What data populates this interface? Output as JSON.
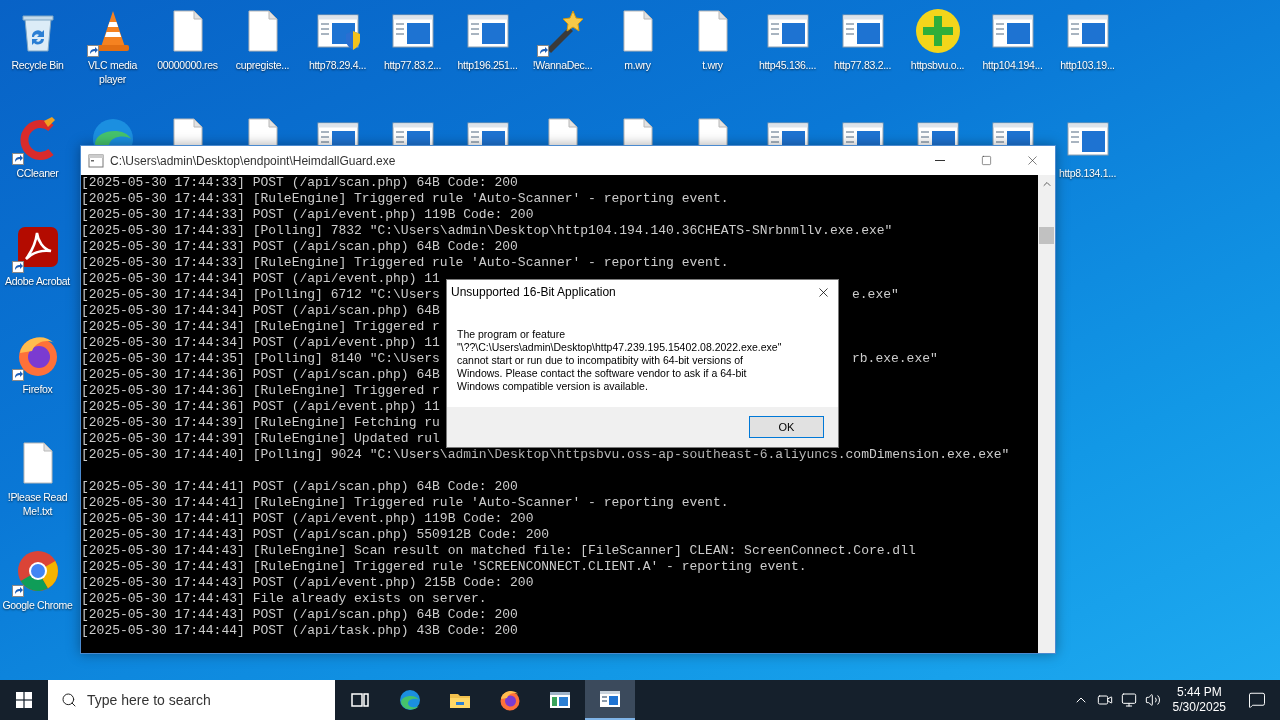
{
  "desktop": {
    "columns": [
      [
        {
          "kind": "recycle",
          "label": "Recycle Bin",
          "shortcut": false
        },
        {
          "kind": "ccleaner",
          "label": "CCleaner",
          "shortcut": true
        },
        {
          "kind": "acrobat",
          "label": "Adobe Acrobat",
          "shortcut": true
        },
        {
          "kind": "firefox",
          "label": "Firefox",
          "shortcut": true
        },
        {
          "kind": "file",
          "label": "!Please Read Me!.txt",
          "shortcut": false
        },
        {
          "kind": "chrome",
          "label": "Google Chrome",
          "shortcut": true
        }
      ],
      [
        {
          "kind": "vlc",
          "label": "VLC media player",
          "shortcut": true
        },
        {
          "kind": "edge",
          "shortcut": false
        }
      ],
      [
        {
          "kind": "file",
          "label": "00000000.res",
          "shortcut": false
        },
        {
          "kind": "file",
          "shortcut": false
        }
      ],
      [
        {
          "kind": "file",
          "label": "cupregiste...",
          "shortcut": false
        },
        {
          "kind": "file",
          "shortcut": false
        }
      ],
      [
        {
          "kind": "window_shield",
          "label": "http78.29.4...",
          "shortcut": false
        },
        {
          "kind": "window",
          "shortcut": false
        }
      ],
      [
        {
          "kind": "window",
          "label": "http77.83.2...",
          "shortcut": false
        },
        {
          "kind": "window",
          "shortcut": false
        }
      ],
      [
        {
          "kind": "window",
          "label": "http196.251...",
          "shortcut": false
        },
        {
          "kind": "window",
          "shortcut": false
        }
      ],
      [
        {
          "kind": "wand",
          "label": "!WannaDec...",
          "shortcut": true
        },
        {
          "kind": "file",
          "shortcut": false
        }
      ],
      [
        {
          "kind": "file",
          "label": "m.wry",
          "shortcut": false
        },
        {
          "kind": "file",
          "shortcut": false
        }
      ],
      [
        {
          "kind": "file",
          "label": "t.wry",
          "shortcut": false
        },
        {
          "kind": "file",
          "shortcut": false
        }
      ],
      [
        {
          "kind": "window",
          "label": "http45.136....",
          "shortcut": false
        },
        {
          "kind": "window",
          "shortcut": false
        }
      ],
      [
        {
          "kind": "window",
          "label": "http77.83.2...",
          "shortcut": false
        },
        {
          "kind": "window",
          "shortcut": false
        }
      ],
      [
        {
          "kind": "plus",
          "label": "httpsbvu.o...",
          "shortcut": false
        },
        {
          "kind": "window",
          "shortcut": false
        }
      ],
      [
        {
          "kind": "window",
          "label": "http104.194...",
          "shortcut": false
        },
        {
          "kind": "window",
          "shortcut": false
        }
      ],
      [
        {
          "kind": "window",
          "label": "http103.19...",
          "shortcut": false
        },
        {
          "kind": "window",
          "label": "http8.134.1...",
          "shortcut": false
        }
      ]
    ]
  },
  "console": {
    "title": "C:\\Users\\admin\\Desktop\\endpoint\\HeimdallGuard.exe",
    "line_groups": [
      [
        {
          "text": "[2025-05-30 17:44:33] POST (/api/scan.php) 64B Code: 200"
        },
        {
          "text": "[2025-05-30 17:44:33] [RuleEngine] Triggered rule 'Auto-Scanner' - reporting event."
        },
        {
          "text": "[2025-05-30 17:44:33] POST (/api/event.php) 119B Code: 200"
        },
        {
          "text": "[2025-05-30 17:44:33] [Polling] 7832 \"C:\\Users\\admin\\Desktop\\http104.194.140.36CHEATS-SNrbnmllv.exe.exe\""
        },
        {
          "text": "[2025-05-30 17:44:33] POST (/api/scan.php) 64B Code: 200"
        },
        {
          "text": "[2025-05-30 17:44:33] [RuleEngine] Triggered rule 'Auto-Scanner' - reporting event."
        },
        {
          "text": "[2025-05-30 17:44:34] POST (/api/event.php) 11"
        },
        {
          "text": "[2025-05-30 17:44:34] [Polling] 6712 \"C:\\Users",
          "tail": "e.exe\""
        },
        {
          "text": "[2025-05-30 17:44:34] POST (/api/scan.php) 64B"
        },
        {
          "text": "[2025-05-30 17:44:34] [RuleEngine] Triggered r"
        },
        {
          "text": "[2025-05-30 17:44:34] POST (/api/event.php) 11"
        },
        {
          "text": "[2025-05-30 17:44:35] [Polling] 8140 \"C:\\Users",
          "tail": "rb.exe.exe\""
        },
        {
          "text": "[2025-05-30 17:44:36] POST (/api/scan.php) 64B"
        },
        {
          "text": "[2025-05-30 17:44:36] [RuleEngine] Triggered r"
        },
        {
          "text": "[2025-05-30 17:44:36] POST (/api/event.php) 11"
        },
        {
          "text": "[2025-05-30 17:44:39] [RuleEngine] Fetching ru"
        },
        {
          "text": "[2025-05-30 17:44:39] [RuleEngine] Updated rul"
        },
        {
          "text": "[2025-05-30 17:44:40] [Polling] 9024 \"C:\\Users\\admin\\Desktop\\httpsbvu.oss-ap-southeast-6.aliyuncs.comDimension.exe.exe\""
        }
      ],
      [
        {
          "text": "[2025-05-30 17:44:41] POST (/api/scan.php) 64B Code: 200"
        },
        {
          "text": "[2025-05-30 17:44:41] [RuleEngine] Triggered rule 'Auto-Scanner' - reporting event."
        },
        {
          "text": "[2025-05-30 17:44:41] POST (/api/event.php) 119B Code: 200"
        },
        {
          "text": "[2025-05-30 17:44:43] POST (/api/scan.php) 550912B Code: 200"
        },
        {
          "text": "[2025-05-30 17:44:43] [RuleEngine] Scan result on matched file: [FileScanner] CLEAN: ScreenConnect.Core.dll"
        },
        {
          "text": "[2025-05-30 17:44:43] [RuleEngine] Triggered rule 'SCREENCONNECT.CLIENT.A' - reporting event."
        },
        {
          "text": "[2025-05-30 17:44:43] POST (/api/event.php) 215B Code: 200"
        },
        {
          "text": "[2025-05-30 17:44:43] File already exists on server."
        },
        {
          "text": "[2025-05-30 17:44:43] POST (/api/scan.php) 64B Code: 200"
        },
        {
          "text": "[2025-05-30 17:44:44] POST (/api/task.php) 43B Code: 200"
        }
      ]
    ]
  },
  "dialog": {
    "title": "Unsupported 16-Bit Application",
    "message": "The program or feature\n\"\\??\\C:\\Users\\admin\\Desktop\\http47.239.195.15402.08.2022.exe.exe\"\ncannot start or run due to incompatibity with 64-bit versions of\nWindows. Please contact the software vendor to ask if a 64-bit\nWindows compatible version is available.",
    "buttons": [
      "OK"
    ]
  },
  "taskbar": {
    "search": {
      "placeholder": "Type here to search"
    },
    "apps": [
      {
        "kind": "taskview",
        "active": false
      },
      {
        "kind": "edge",
        "active": false
      },
      {
        "kind": "explorer",
        "active": false
      },
      {
        "kind": "firefox",
        "active": false
      },
      {
        "kind": "app",
        "active": false
      },
      {
        "kind": "console",
        "active": true
      }
    ],
    "tray_icons": [
      {
        "kind": "chevron"
      },
      {
        "kind": "meet"
      },
      {
        "kind": "network"
      },
      {
        "kind": "volume"
      }
    ],
    "clock": {
      "time": "5:44 PM",
      "date": "5/30/2025"
    }
  }
}
